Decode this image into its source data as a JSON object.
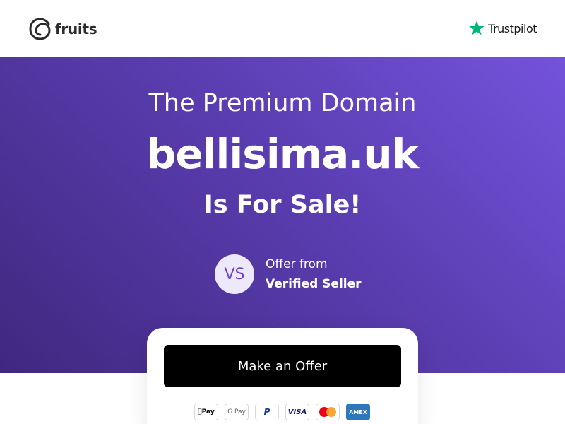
{
  "header": {
    "logo_text": "fruits",
    "trustpilot_text": "Trustpilot"
  },
  "hero": {
    "line1": "The Premium Domain",
    "domain": "bellisima.uk",
    "line3": "Is For Sale!"
  },
  "seller": {
    "avatar_initials": "VS",
    "line1": "Offer from",
    "line2": "Verified Seller"
  },
  "offer_card": {
    "button_label": "Make an Offer",
    "payment_methods": {
      "apple_pay": "Pay",
      "google_pay": "G Pay",
      "paypal": "P",
      "visa": "VISA",
      "amex": "AMEX"
    }
  },
  "colors": {
    "hero_gradient_start": "#7453dc",
    "hero_gradient_end": "#40287f",
    "trustpilot_green": "#00b67a",
    "button_bg": "#000000",
    "avatar_bg": "#eee8fb",
    "avatar_text": "#6a44c8"
  },
  "icons": [
    "fruits-logo-icon",
    "trustpilot-star-icon",
    "apple-pay-icon",
    "google-pay-icon",
    "paypal-icon",
    "visa-icon",
    "mastercard-icon",
    "amex-icon"
  ]
}
